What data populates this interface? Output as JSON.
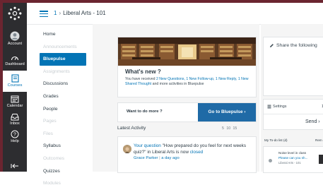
{
  "breadcrumb": {
    "course_number": "1",
    "separator": "›",
    "course_name": "Liberal Arts - 101"
  },
  "global_nav": {
    "items": [
      {
        "label": "Account",
        "icon": "account-icon"
      },
      {
        "label": "Dashboard",
        "icon": "dashboard-icon"
      },
      {
        "label": "Courses",
        "icon": "courses-icon",
        "active": true
      },
      {
        "label": "Calendar",
        "icon": "calendar-icon"
      },
      {
        "label": "Inbox",
        "icon": "inbox-icon"
      },
      {
        "label": "Help",
        "icon": "help-icon"
      }
    ],
    "collapse_icon": "collapse-arrow-icon"
  },
  "course_nav": {
    "items": [
      {
        "label": "Home",
        "state": "normal"
      },
      {
        "label": "Announcements",
        "state": "disabled"
      },
      {
        "label": "Bluepulse",
        "state": "active"
      },
      {
        "label": "Assignments",
        "state": "disabled"
      },
      {
        "label": "Discussions",
        "state": "normal"
      },
      {
        "label": "Grades",
        "state": "normal"
      },
      {
        "label": "People",
        "state": "normal"
      },
      {
        "label": "Pages",
        "state": "disabled"
      },
      {
        "label": "Files",
        "state": "disabled"
      },
      {
        "label": "Syllabus",
        "state": "normal"
      },
      {
        "label": "Outcomes",
        "state": "disabled"
      },
      {
        "label": "Quizzes",
        "state": "normal"
      },
      {
        "label": "Modules",
        "state": "disabled"
      }
    ]
  },
  "whats_new": {
    "title": "What's new ?",
    "text_prefix": "You have received",
    "link_new_questions": "2 New Questions,",
    "link_new_followup": "1 New Follow-up,",
    "link_new_reply": "1 New Reply,",
    "link_new_shared": "1 New Shared Thought",
    "text_suffix": "and more activities in Bluepulse"
  },
  "todo_prompt": {
    "question": "Want to do more ?",
    "button_label": "Go to Bluepulse ›"
  },
  "latest_activity": {
    "title": "Latest Activity",
    "page_sizes": "5  10  15",
    "items": [
      {
        "link_label": "Your question",
        "text": "\"How prepared do you feel for next weeks quiz?\" in Liberal Arts is now",
        "status_link": "closed",
        "author": "Grace Parker",
        "separator": "|",
        "time": "a day ago"
      }
    ]
  },
  "share": {
    "placeholder": "Share the following"
  },
  "settings": {
    "label": "Settings",
    "count": "1",
    "send_label": "Send ›"
  },
  "todo_list": {
    "title": "My To-do list (d)",
    "title_right": "Rem",
    "items": [
      {
        "title": "Noise level in class",
        "link": "Please can you sh...",
        "course": "Liberal Arts - 101"
      }
    ]
  },
  "colors": {
    "accent": "#0374b5",
    "global_nav_bg": "#2d2d30",
    "frame_border": "#6b2530",
    "bluepulse_button": "#1f6aa6"
  }
}
